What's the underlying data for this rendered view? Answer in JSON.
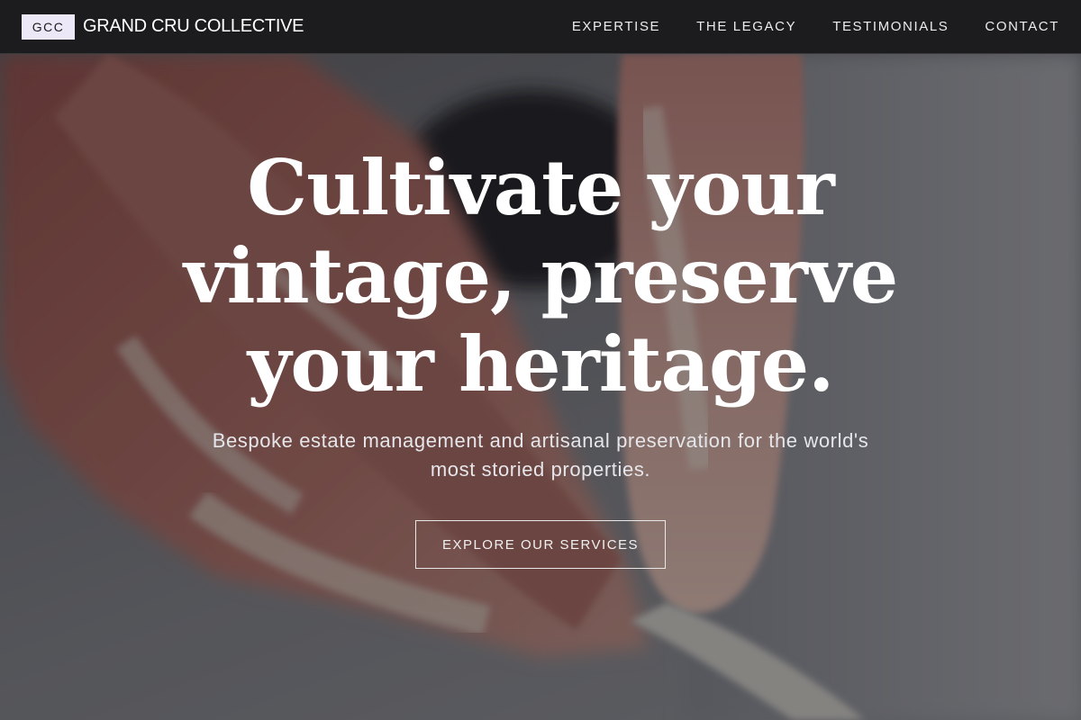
{
  "header": {
    "logo_badge": "GCC",
    "brand_name": "GRAND CRU COLLECTIVE",
    "nav": [
      {
        "label": "EXPERTISE"
      },
      {
        "label": "THE LEGACY"
      },
      {
        "label": "TESTIMONIALS"
      },
      {
        "label": "CONTACT"
      }
    ]
  },
  "hero": {
    "headline_line1": "Cultivate your",
    "headline_line2": "vintage, preserve",
    "headline_line3": "your heritage.",
    "subtitle_line1": "Bespoke estate management and artisanal preservation for the world's",
    "subtitle_line2": "most storied properties.",
    "cta_label": "EXPLORE OUR SERVICES",
    "background_image": "hands-shaping-clay-photo"
  },
  "colors": {
    "header_bg": "#1c1c1e",
    "badge_bg": "#ece8f7",
    "text_light": "#ffffff"
  }
}
